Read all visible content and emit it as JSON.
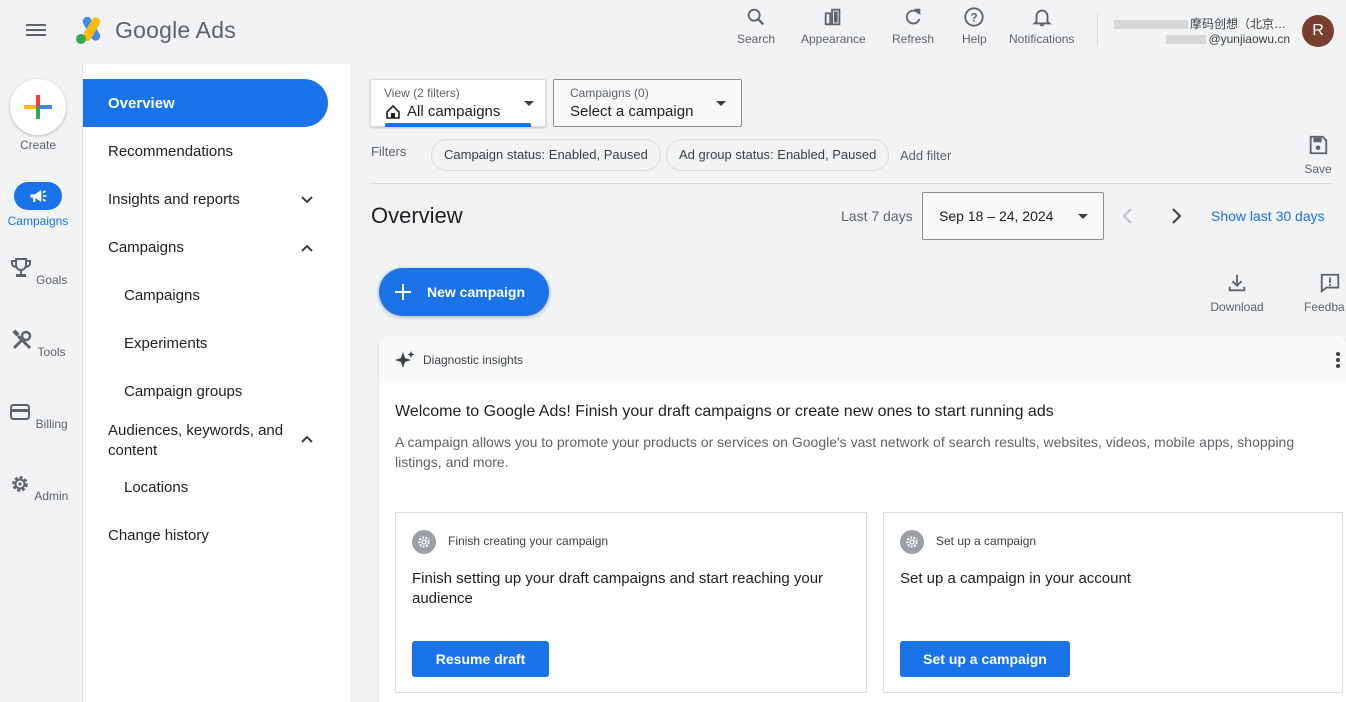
{
  "header": {
    "app_name": "Google Ads",
    "buttons": {
      "search": "Search",
      "appearance": "Appearance",
      "refresh": "Refresh",
      "help": "Help",
      "notifications": "Notifications"
    },
    "account_name": "摩码创想（北京…",
    "account_email": "@yunjiaowu.cn",
    "avatar_letter": "R"
  },
  "rail": {
    "create": "Create",
    "campaigns": "Campaigns",
    "goals": "Goals",
    "tools": "Tools",
    "billing": "Billing",
    "admin": "Admin"
  },
  "nav": {
    "overview": "Overview",
    "recommendations": "Recommendations",
    "insights": "Insights and reports",
    "campaigns_group": "Campaigns",
    "campaigns": "Campaigns",
    "experiments": "Experiments",
    "campaign_groups": "Campaign groups",
    "audiences_line1": "Audiences, keywords, and",
    "audiences_line2": "content",
    "locations": "Locations",
    "change_history": "Change history"
  },
  "filters": {
    "view_label": "View (2 filters)",
    "view_value": "All campaigns",
    "campaigns_label": "Campaigns (0)",
    "campaigns_value": "Select a campaign",
    "filters_label": "Filters",
    "chip_campaign_status": "Campaign status: Enabled, Paused",
    "chip_adgroup_status": "Ad group status: Enabled, Paused",
    "add_filter": "Add filter",
    "save": "Save"
  },
  "overview": {
    "title": "Overview",
    "range_label": "Last 7 days",
    "date_range": "Sep 18 – 24, 2024",
    "show_last_30": "Show last 30 days",
    "new_campaign": "New campaign",
    "download": "Download",
    "feedback": "Feedba"
  },
  "card": {
    "header": "Diagnostic insights",
    "heading": "Welcome to Google Ads! Finish your draft campaigns or create new ones to start running ads",
    "desc_line1": "A campaign allows you to promote your products or services on Google's vast network of search results, websites, videos, mobile apps, shopping",
    "desc_line2": "listings, and more.",
    "left": {
      "title": "Finish creating your campaign",
      "body_line1": "Finish setting up your draft campaigns and start reaching your",
      "body_line2": "audience",
      "button": "Resume draft"
    },
    "right": {
      "title": "Set up a campaign",
      "body": "Set up a campaign in your account",
      "button": "Set up a campaign"
    }
  },
  "colors": {
    "accent": "#1a73e8",
    "avatar": "#7a3e2e",
    "background": "#f1f3f4"
  }
}
